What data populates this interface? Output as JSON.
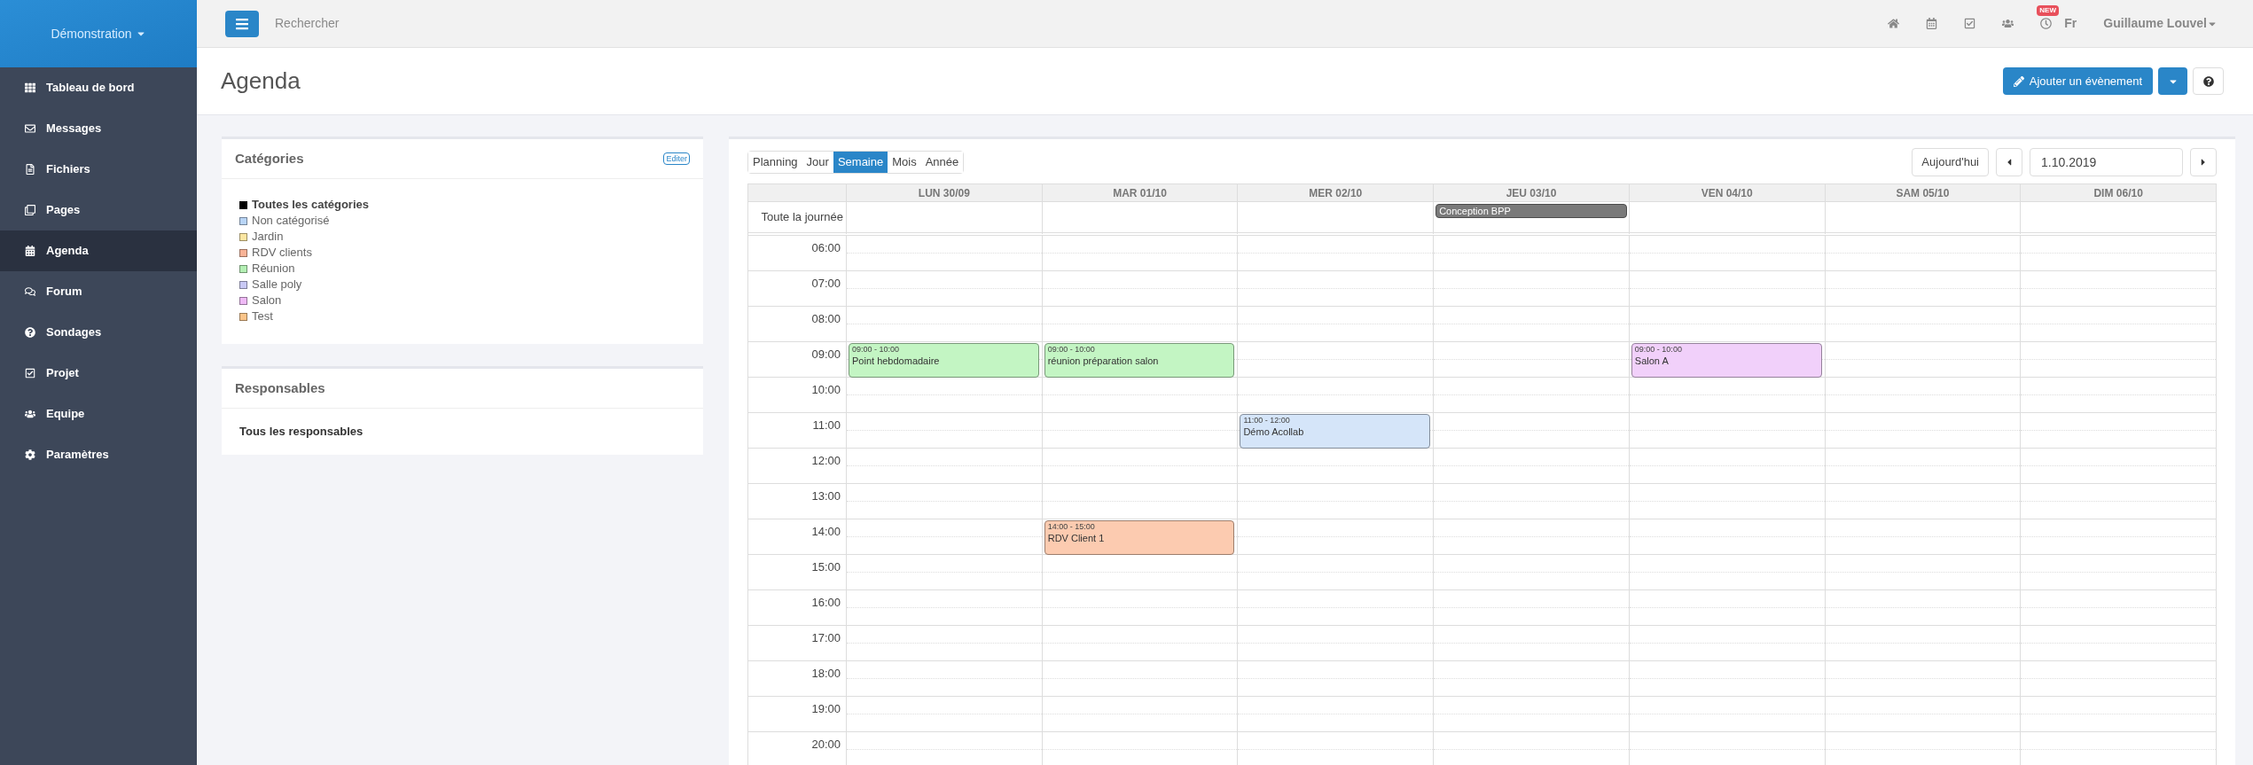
{
  "sidebar": {
    "brand": "Démonstration",
    "items": [
      {
        "label": "Tableau de bord",
        "selected": false
      },
      {
        "label": "Messages",
        "selected": false
      },
      {
        "label": "Fichiers",
        "selected": false
      },
      {
        "label": "Pages",
        "selected": false
      },
      {
        "label": "Agenda",
        "selected": true
      },
      {
        "label": "Forum",
        "selected": false
      },
      {
        "label": "Sondages",
        "selected": false
      },
      {
        "label": "Projet",
        "selected": false
      },
      {
        "label": "Equipe",
        "selected": false
      },
      {
        "label": "Paramètres",
        "selected": false
      }
    ]
  },
  "topbar": {
    "search": "Rechercher",
    "badge": "NEW",
    "language": "Fr",
    "user": "Guillaume Louvel"
  },
  "page": {
    "title": "Agenda",
    "add_button": "Ajouter un évènement"
  },
  "categories": {
    "title": "Catégories",
    "edit": "Editer",
    "items": [
      {
        "label": "Toutes les catégories",
        "color": "#000000",
        "selected": true
      },
      {
        "label": "Non catégorisé",
        "color": "#b9d5f6",
        "selected": false
      },
      {
        "label": "Jardin",
        "color": "#fbe6a2",
        "selected": false
      },
      {
        "label": "RDV clients",
        "color": "#f8b396",
        "selected": false
      },
      {
        "label": "Réunion",
        "color": "#b4efb4",
        "selected": false
      },
      {
        "label": "Salle poly",
        "color": "#c9c9f5",
        "selected": false
      },
      {
        "label": "Salon",
        "color": "#efbaf6",
        "selected": false
      },
      {
        "label": "Test",
        "color": "#fac489",
        "selected": false
      }
    ]
  },
  "responsables": {
    "title": "Responsables",
    "items": [
      {
        "label": "Tous les responsables",
        "selected": true
      }
    ]
  },
  "calendar": {
    "views": [
      {
        "label": "Planning",
        "selected": false
      },
      {
        "label": "Jour",
        "selected": false
      },
      {
        "label": "Semaine",
        "selected": true
      },
      {
        "label": "Mois",
        "selected": false
      },
      {
        "label": "Année",
        "selected": false
      }
    ],
    "today": "Aujourd'hui",
    "date": "1.10.2019",
    "all_day_label": "Toute la journée",
    "hours": [
      "06:00",
      "07:00",
      "08:00",
      "09:00",
      "10:00",
      "11:00",
      "12:00",
      "13:00",
      "14:00",
      "15:00",
      "16:00",
      "17:00",
      "18:00",
      "19:00",
      "20:00"
    ],
    "days": [
      {
        "label": "LUN 30/09",
        "events": [
          {
            "time": "09:00 - 10:00",
            "title": "Point hebdomadaire",
            "color": "#c3f5c3"
          }
        ]
      },
      {
        "label": "MAR 01/10",
        "events": [
          {
            "time": "09:00 - 10:00",
            "title": "réunion préparation salon",
            "color": "#c3f5c3"
          },
          {
            "time": "14:00 - 15:00",
            "title": "RDV Client 1",
            "color": "#fccbb0"
          }
        ]
      },
      {
        "label": "MER 02/10",
        "events": [
          {
            "time": "11:00 - 12:00",
            "title": "Démo Acollab",
            "color": "#d5e5f9"
          }
        ]
      },
      {
        "label": "JEU 03/10",
        "all_day": [
          {
            "title": "Conception BPP",
            "color": "#7a7a7a"
          }
        ]
      },
      {
        "label": "VEN 04/10",
        "events": [
          {
            "time": "09:00 - 10:00",
            "title": "Salon A",
            "color": "#f1d0fa"
          }
        ]
      },
      {
        "label": "SAM 05/10"
      },
      {
        "label": "DIM 06/10"
      }
    ]
  }
}
